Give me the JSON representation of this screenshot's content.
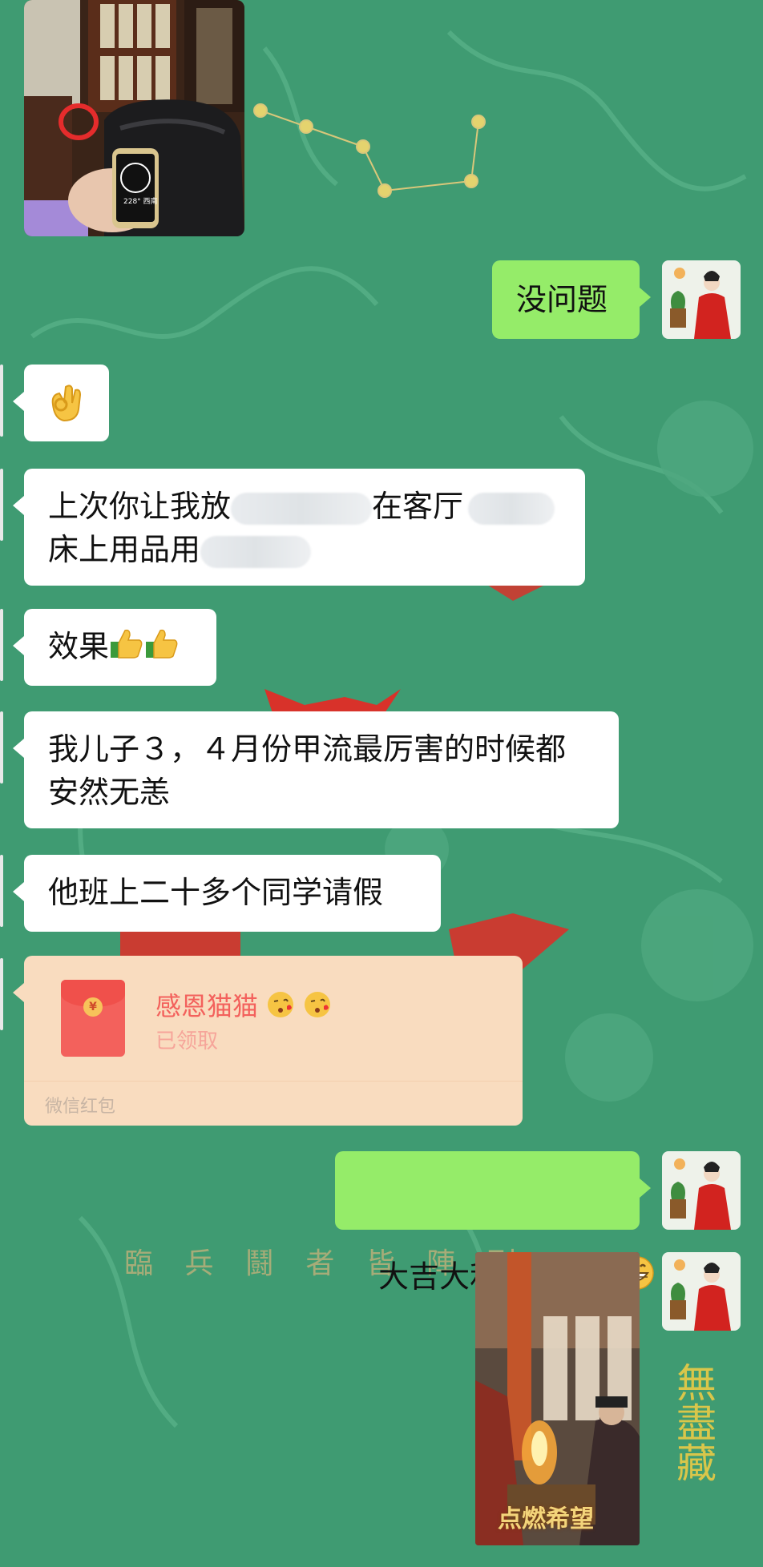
{
  "messages": {
    "m1": {
      "text": "没问题"
    },
    "m2": {
      "emoji": "ok-hand-emoji"
    },
    "m3": {
      "line1a": "上次你让我放",
      "line1b": "在客厅",
      "line2a": "床上用品用"
    },
    "m4": {
      "text": "效果"
    },
    "m5": {
      "line1": "我儿子３，４月份甲流最厉害的时候都",
      "line2": "安然无恙"
    },
    "m6": {
      "text": "他班上二十多个同学请假"
    },
    "red_packet": {
      "title": "感恩猫猫",
      "status": "已领取",
      "footer": "微信红包"
    },
    "m7": {
      "text": "大吉大利  加油"
    }
  },
  "background_text": {
    "incantation": "臨 兵 鬪 者 皆 陣 列",
    "vertical_poem": "無盡藏"
  },
  "video_caption": "点燃希望",
  "colors": {
    "chat_bg": "#3f9b72",
    "incoming_bubble": "#ffffff",
    "outgoing_bubble": "#95ec69",
    "red_packet_bg": "#f9dcbf",
    "red_packet_accent": "#f3615c"
  }
}
